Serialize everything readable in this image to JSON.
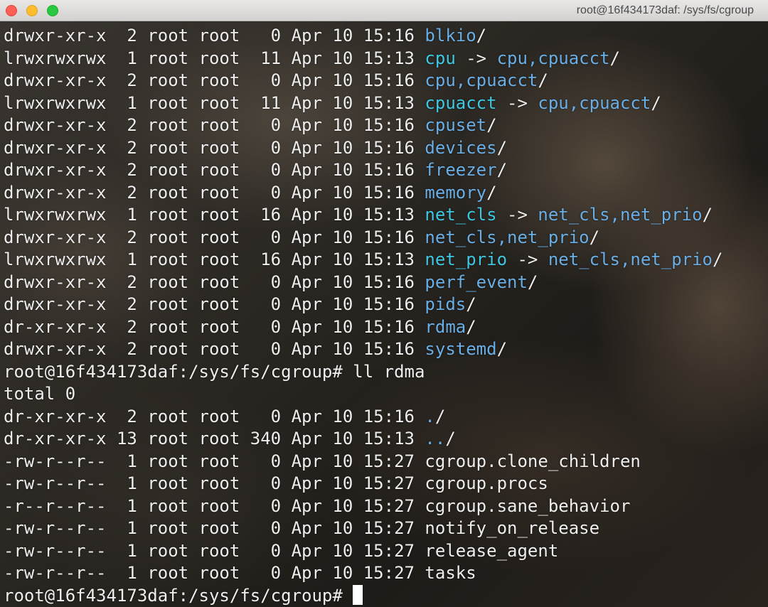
{
  "window": {
    "title": "root@16f434173daf: /sys/fs/cgroup"
  },
  "terminal": {
    "listing": [
      {
        "meta": "drwxr-xr-x  2 root root   0 Apr 10 15:16 ",
        "name": "blkio",
        "kind": "dir",
        "suffix": "/"
      },
      {
        "meta": "lrwxrwxrwx  1 root root  11 Apr 10 15:13 ",
        "name": "cpu",
        "kind": "link",
        "arrow": " -> ",
        "target": "cpu,cpuacct",
        "suffix": "/"
      },
      {
        "meta": "drwxr-xr-x  2 root root   0 Apr 10 15:16 ",
        "name": "cpu,cpuacct",
        "kind": "dir",
        "suffix": "/"
      },
      {
        "meta": "lrwxrwxrwx  1 root root  11 Apr 10 15:13 ",
        "name": "cpuacct",
        "kind": "link",
        "arrow": " -> ",
        "target": "cpu,cpuacct",
        "suffix": "/"
      },
      {
        "meta": "drwxr-xr-x  2 root root   0 Apr 10 15:16 ",
        "name": "cpuset",
        "kind": "dir",
        "suffix": "/"
      },
      {
        "meta": "drwxr-xr-x  2 root root   0 Apr 10 15:16 ",
        "name": "devices",
        "kind": "dir",
        "suffix": "/"
      },
      {
        "meta": "drwxr-xr-x  2 root root   0 Apr 10 15:16 ",
        "name": "freezer",
        "kind": "dir",
        "suffix": "/"
      },
      {
        "meta": "drwxr-xr-x  2 root root   0 Apr 10 15:16 ",
        "name": "memory",
        "kind": "dir",
        "suffix": "/"
      },
      {
        "meta": "lrwxrwxrwx  1 root root  16 Apr 10 15:13 ",
        "name": "net_cls",
        "kind": "link",
        "arrow": " -> ",
        "target": "net_cls,net_prio",
        "suffix": "/"
      },
      {
        "meta": "drwxr-xr-x  2 root root   0 Apr 10 15:16 ",
        "name": "net_cls,net_prio",
        "kind": "dir",
        "suffix": "/"
      },
      {
        "meta": "lrwxrwxrwx  1 root root  16 Apr 10 15:13 ",
        "name": "net_prio",
        "kind": "link",
        "arrow": " -> ",
        "target": "net_cls,net_prio",
        "suffix": "/"
      },
      {
        "meta": "drwxr-xr-x  2 root root   0 Apr 10 15:16 ",
        "name": "perf_event",
        "kind": "dir",
        "suffix": "/"
      },
      {
        "meta": "drwxr-xr-x  2 root root   0 Apr 10 15:16 ",
        "name": "pids",
        "kind": "dir",
        "suffix": "/"
      },
      {
        "meta": "dr-xr-xr-x  2 root root   0 Apr 10 15:16 ",
        "name": "rdma",
        "kind": "dir",
        "suffix": "/"
      },
      {
        "meta": "drwxr-xr-x  2 root root   0 Apr 10 15:16 ",
        "name": "systemd",
        "kind": "dir",
        "suffix": "/"
      }
    ],
    "command_line": "root@16f434173daf:/sys/fs/cgroup# ll rdma",
    "total_line": "total 0",
    "rdma_listing": [
      {
        "meta": "dr-xr-xr-x  2 root root   0 Apr 10 15:16 ",
        "name": ".",
        "kind": "dir",
        "suffix": "/"
      },
      {
        "meta": "dr-xr-xr-x 13 root root 340 Apr 10 15:13 ",
        "name": "..",
        "kind": "dir",
        "suffix": "/"
      },
      {
        "meta": "-rw-r--r--  1 root root   0 Apr 10 15:27 ",
        "name": "cgroup.clone_children",
        "kind": "file",
        "suffix": ""
      },
      {
        "meta": "-rw-r--r--  1 root root   0 Apr 10 15:27 ",
        "name": "cgroup.procs",
        "kind": "file",
        "suffix": ""
      },
      {
        "meta": "-r--r--r--  1 root root   0 Apr 10 15:27 ",
        "name": "cgroup.sane_behavior",
        "kind": "file",
        "suffix": ""
      },
      {
        "meta": "-rw-r--r--  1 root root   0 Apr 10 15:27 ",
        "name": "notify_on_release",
        "kind": "file",
        "suffix": ""
      },
      {
        "meta": "-rw-r--r--  1 root root   0 Apr 10 15:27 ",
        "name": "release_agent",
        "kind": "file",
        "suffix": ""
      },
      {
        "meta": "-rw-r--r--  1 root root   0 Apr 10 15:27 ",
        "name": "tasks",
        "kind": "file",
        "suffix": ""
      }
    ],
    "prompt": "root@16f434173daf:/sys/fs/cgroup# "
  },
  "colors": {
    "directory": "#6aaee6",
    "symlink": "#3ec8e2",
    "text": "#eeeeee",
    "cursor": "#ffffff"
  }
}
